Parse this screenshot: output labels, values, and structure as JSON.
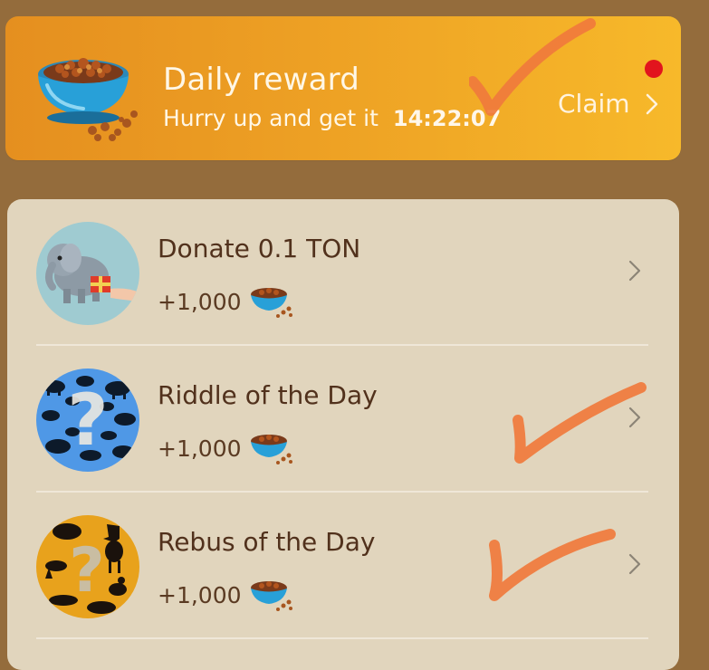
{
  "daily": {
    "title": "Daily reward",
    "subtitle": "Hurry up and get it",
    "timer": "14:22:07",
    "claim_label": "Claim",
    "chevron": "›"
  },
  "tasks": [
    {
      "title": "Donate 0.1 TON",
      "reward": "+1,000",
      "avatar_icon": "elephant-gift-icon"
    },
    {
      "title": "Riddle of the Day",
      "reward": "+1,000",
      "avatar_icon": "animal-silhouettes-question-icon"
    },
    {
      "title": "Rebus of the Day",
      "reward": "+1,000",
      "avatar_icon": "forest-animals-question-icon"
    }
  ],
  "colors": {
    "background": "#946c3c",
    "banner_start": "#e58f1f",
    "banner_end": "#f7b92a",
    "list_bg": "#e1d5bd",
    "accent_check": "#f07a3c",
    "notification_dot": "#e2141d"
  }
}
